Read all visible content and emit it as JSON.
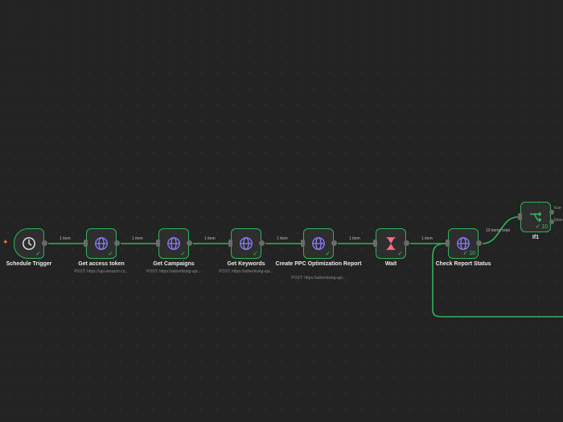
{
  "workflow": {
    "trigger_icon": "bolt-icon",
    "nodes": [
      {
        "id": "schedule-trigger",
        "title": "Schedule Trigger",
        "subtitle": "",
        "icon": "clock-icon",
        "status": "✓",
        "count": ""
      },
      {
        "id": "get-access-token",
        "title": "Get access token",
        "subtitle": "POST: https://api.amazon.co...",
        "icon": "globe-icon",
        "status": "✓",
        "count": ""
      },
      {
        "id": "get-campaigns",
        "title": "Get Campaigns",
        "subtitle": "POST: https://advertising-api...",
        "icon": "globe-icon",
        "status": "✓",
        "count": ""
      },
      {
        "id": "get-keywords",
        "title": "Get Keywords",
        "subtitle": "POST: https://advertising-api...",
        "icon": "globe-icon",
        "status": "✓",
        "count": ""
      },
      {
        "id": "create-ppc-report",
        "title": "Create PPC Optimization Report",
        "subtitle": "POST: https://advertising-api...",
        "icon": "globe-icon",
        "status": "✓",
        "count": ""
      },
      {
        "id": "wait",
        "title": "Wait",
        "subtitle": "",
        "icon": "hourglass-icon",
        "status": "✓",
        "count": ""
      },
      {
        "id": "check-report-status",
        "title": "Check Report Status",
        "subtitle": "",
        "icon": "globe-icon",
        "status": "✓",
        "count": "10"
      },
      {
        "id": "if1",
        "title": "If1",
        "subtitle": "",
        "icon": "branch-icon",
        "status": "✓",
        "count": "10"
      }
    ],
    "edges": [
      {
        "label": "1 item"
      },
      {
        "label": "1 item"
      },
      {
        "label": "1 item"
      },
      {
        "label": "1 item"
      },
      {
        "label": "1 item"
      },
      {
        "label": "1 item"
      },
      {
        "label": "10 items total"
      }
    ],
    "if_branches": {
      "true_label": "true",
      "false_label": "false"
    },
    "colors": {
      "background": "#232323",
      "success": "#2fb45a",
      "globe": "#8b7cf6",
      "hourglass": "#ff6d7e",
      "trigger_spark": "#ff6d3a"
    }
  }
}
